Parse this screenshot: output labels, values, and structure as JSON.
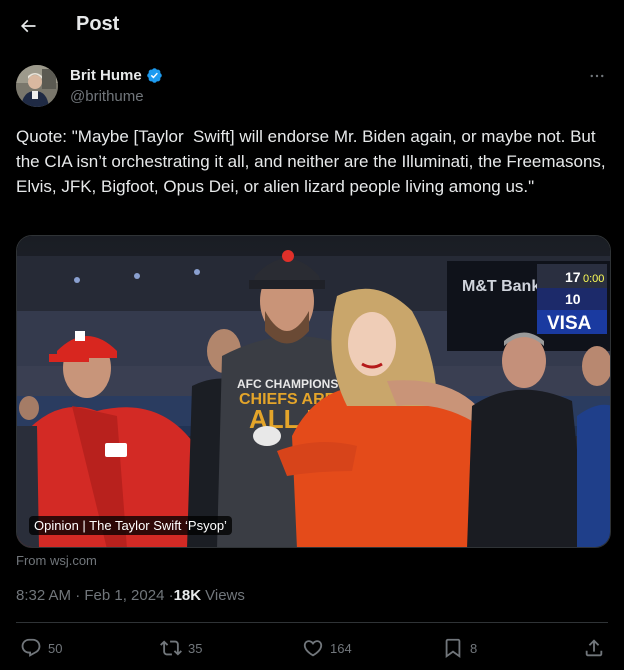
{
  "header": {
    "title": "Post",
    "back_icon": "arrow-left-icon"
  },
  "author": {
    "name": "Brit Hume",
    "handle": "@brithume",
    "verified": true,
    "verified_color": "#1d9bf0"
  },
  "tweet": {
    "text": "Quote: \"Maybe [Taylor  Swift] will endorse Mr. Biden again, or maybe not. But the CIA isn’t orchestrating it all, and neither are the Illuminati, the Freemasons, Elvis, JFK, Bigfoot, Opus Dei, or alien lizard people living among us.\""
  },
  "card": {
    "label": "Opinion | The Taylor Swift ‘Psyop’",
    "from": "From wsj.com",
    "image_text": {
      "sponsor": "M&T Bank",
      "visa": "VISA",
      "score_1": "17",
      "score_2": "10",
      "clock": "0:00",
      "shirt_1": "AFC CHAMPIONS",
      "shirt_2": "CHIEFS ARE",
      "shirt_3": "ALL IN"
    }
  },
  "meta": {
    "time": "8:32 AM · Feb 1, 2024 · ",
    "views_count": "18K",
    "views_label": "Views"
  },
  "actions": {
    "replies": "50",
    "reposts": "35",
    "likes": "164",
    "bookmarks": "8"
  },
  "colors": {
    "background": "#000000",
    "text": "#e7e9ea",
    "muted": "#71767b",
    "border": "#2f3336",
    "accent": "#1d9bf0"
  }
}
